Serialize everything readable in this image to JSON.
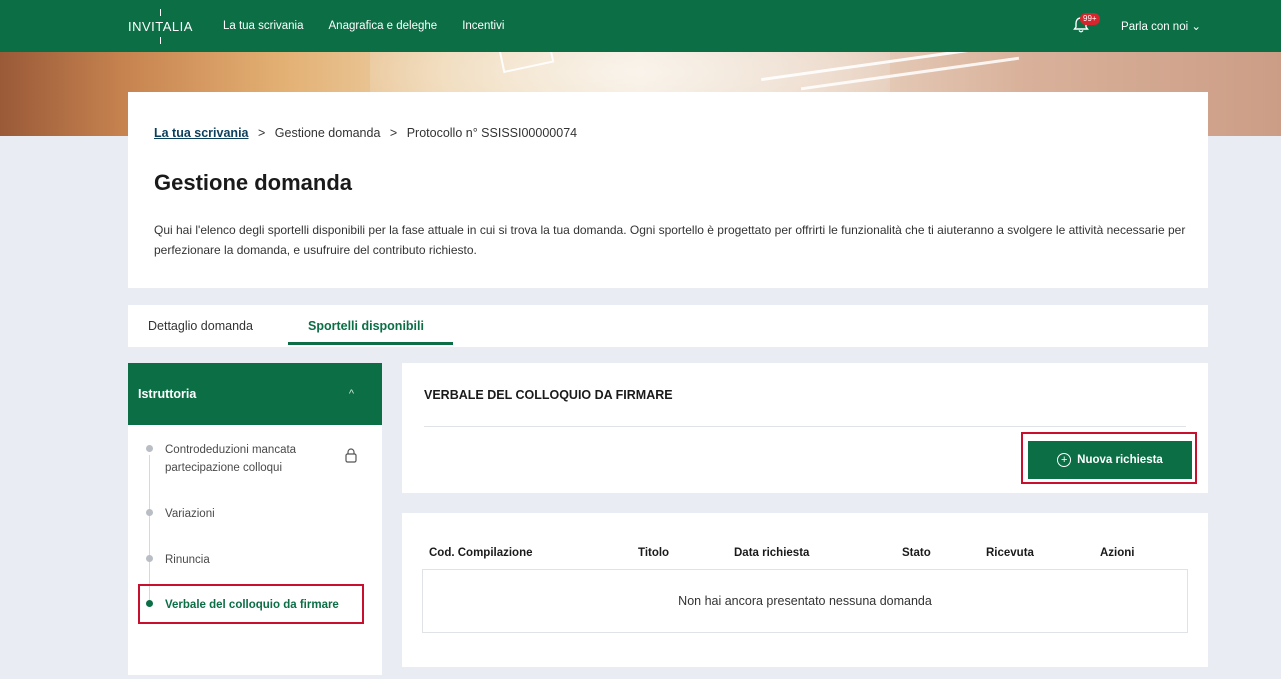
{
  "topbar": {
    "brand": "INVITALIA",
    "nav": [
      "La tua scrivania",
      "Anagrafica e deleghe",
      "Incentivi"
    ],
    "notifications_badge": "99+",
    "talk_label": "Parla con noi",
    "talk_chevron": "⌄"
  },
  "breadcrumb": {
    "home": "La tua scrivania",
    "separator": ">",
    "items": [
      "Gestione domanda",
      "Protocollo n° SSISSI00000074"
    ]
  },
  "page": {
    "title": "Gestione domanda",
    "description": "Qui hai l'elenco degli sportelli disponibili per la fase attuale in cui si trova la tua domanda. Ogni sportello è progettato per offrirti le funzionalità che ti aiuteranno a svolgere le attività necessarie per perfezionare la domanda, e usufruire del contributo richiesto."
  },
  "tabs": [
    {
      "label": "Dettaglio domanda",
      "active": false
    },
    {
      "label": "Sportelli disponibili",
      "active": true
    }
  ],
  "sidebar": {
    "section": "Istruttoria",
    "chevron": "^",
    "steps": [
      {
        "label": "Controdeduzioni mancata partecipazione colloqui",
        "locked": true,
        "active": false
      },
      {
        "label": "Variazioni",
        "active": false
      },
      {
        "label": "Rinuncia",
        "active": false
      },
      {
        "label": "Verbale del colloquio da firmare",
        "active": true
      }
    ]
  },
  "panel": {
    "title": "VERBALE DEL COLLOQUIO DA FIRMARE",
    "new_button": "Nuova richiesta",
    "plus": "+"
  },
  "table": {
    "columns": [
      "Cod. Compilazione",
      "Titolo",
      "Data richiesta",
      "Stato",
      "Ricevuta",
      "Azioni"
    ],
    "empty_message": "Non hai ancora presentato nessuna domanda"
  },
  "colors": {
    "primary": "#0b6e45",
    "highlight": "#c8102e",
    "badge": "#d8242c"
  }
}
